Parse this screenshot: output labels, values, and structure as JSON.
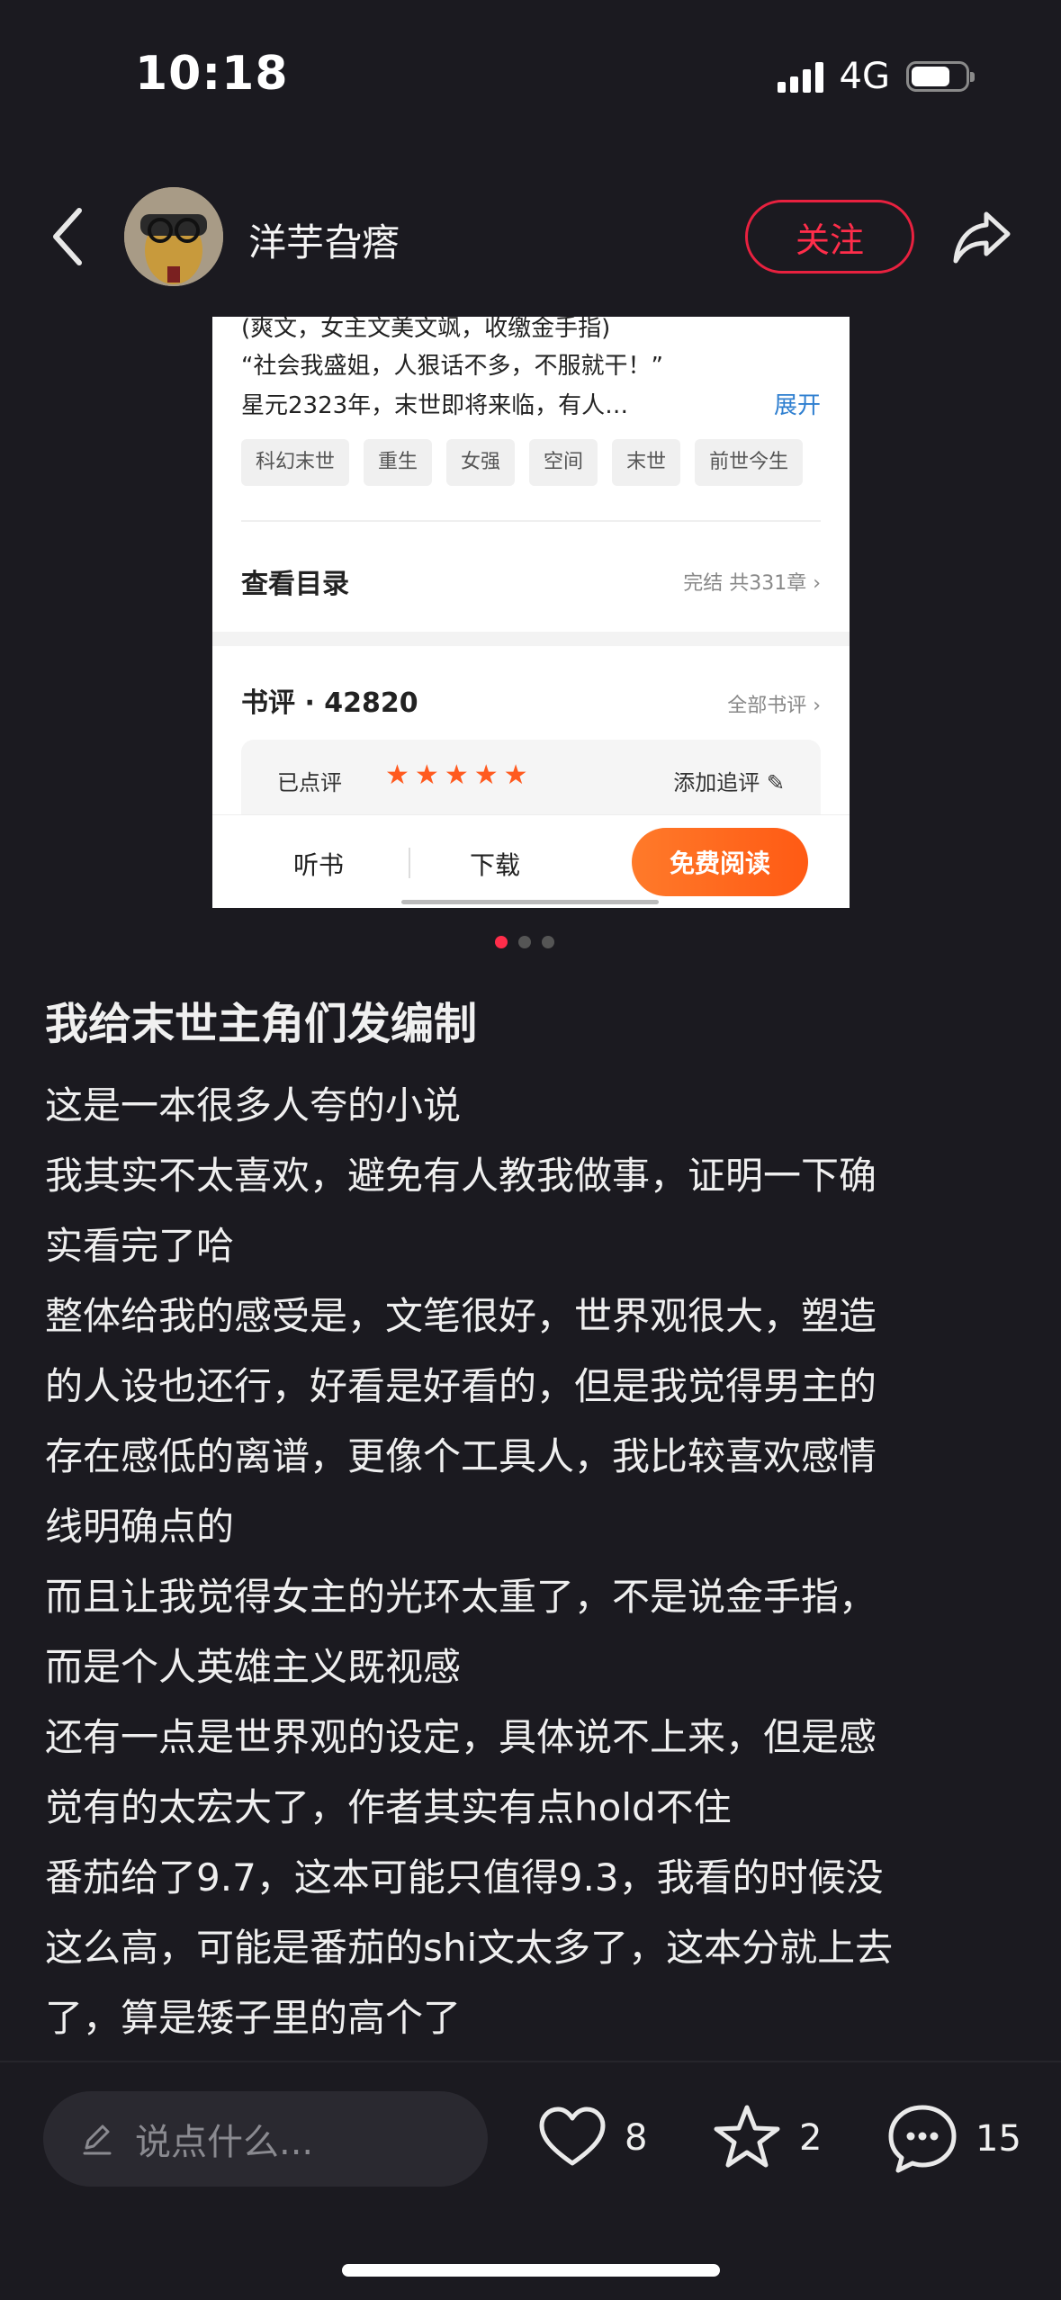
{
  "status_bar": {
    "time": "10:18",
    "network": "4G",
    "battery_level": 0.72
  },
  "header": {
    "username": "洋芋旮瘩",
    "follow_label": "关注"
  },
  "card": {
    "desc_lines": [
      "(爽文，女主文美文飒，收缴金手指)",
      "“社会我盛姐，人狠话不多，不服就干！”",
      "星元2323年，末世即将来临，有人…"
    ],
    "expand_label": "展开",
    "tags": [
      "科幻末世",
      "重生",
      "女强",
      "空间",
      "末世",
      "前世今生"
    ],
    "catalog_label": "查看目录",
    "catalog_meta": "完结 共331章 ›",
    "review_title": "书评 · 42820",
    "all_reviews_label": "全部书评 ›",
    "rated_label": "已点评",
    "stars": 5,
    "add_review_label": "添加追评",
    "listen_label": "听书",
    "download_label": "下载",
    "read_label": "免费阅读"
  },
  "pager": {
    "count": 3,
    "active": 1
  },
  "post": {
    "title": "我给末世主角们发编制",
    "lines": [
      "这是一本很多人夸的小说",
      "我其实不太喜欢，避免有人教我做事，证明一下确",
      "实看完了哈",
      "整体给我的感受是，文笔很好，世界观很大，塑造",
      "的人设也还行，好看是好看的，但是我觉得男主的",
      "存在感低的离谱，更像个工具人，我比较喜欢感情",
      "线明确点的",
      "而且让我觉得女主的光环太重了，不是说金手指，",
      "而是个人英雄主义既视感",
      "还有一点是世界观的设定，具体说不上来，但是感",
      "觉有的太宏大了，作者其实有点hold不住",
      "番茄给了9.7，这本可能只值得9.3，我看的时候没",
      "这么高，可能是番茄的shi文太多了，这本分就上去",
      "了，算是矮子里的高个了"
    ]
  },
  "actions": {
    "comment_placeholder": "说点什么...",
    "likes": "8",
    "favorites": "2",
    "comments": "15"
  },
  "colors": {
    "accent": "#ff2d4a",
    "read_button": "#ff5a14",
    "background": "#1b1a20"
  }
}
